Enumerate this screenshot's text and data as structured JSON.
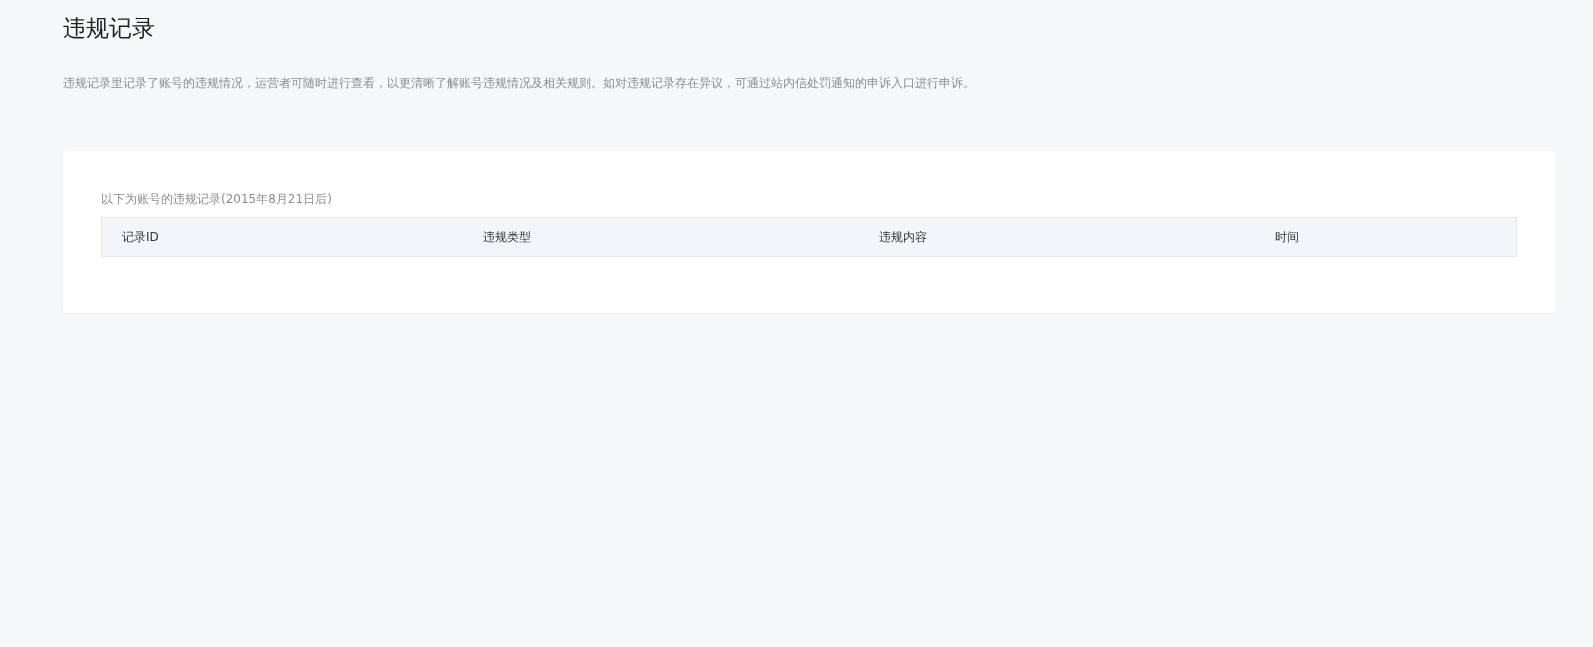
{
  "page": {
    "title": "违规记录",
    "description": "违规记录里记录了账号的违规情况，运营者可随时进行查看，以更清晰了解账号违规情况及相关规则。如对违规记录存在异议，可通过站内信处罚通知的申诉入口进行申诉。"
  },
  "table": {
    "caption": "以下为账号的违规记录(2015年8月21日后)",
    "columns": [
      "记录ID",
      "违规类型",
      "违规内容",
      "时间"
    ]
  }
}
